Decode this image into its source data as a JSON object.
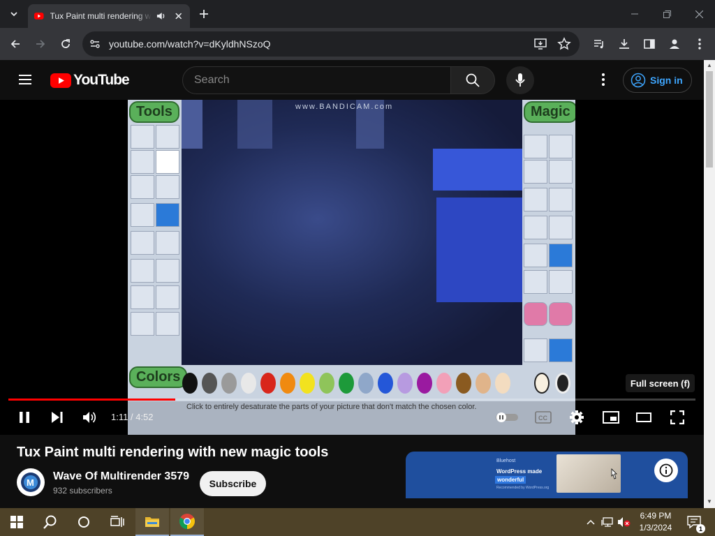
{
  "browser": {
    "tab_title": "Tux Paint multi rendering w",
    "url": "youtube.com/watch?v=dKyldhNSzoQ"
  },
  "youtube": {
    "logo_text": "YouTube",
    "search_placeholder": "Search",
    "sign_in_label": "Sign in"
  },
  "video": {
    "watermark": "www.BANDICAM.com",
    "tuxpaint_tools_label": "Tools",
    "tuxpaint_magic_label": "Magic",
    "tuxpaint_colors_label": "Colors",
    "tuxpaint_status": "Click to entirely desaturate the parts of your picture that don't match the chosen color.",
    "tuxpaint_swatches": [
      "#111111",
      "#555555",
      "#9a9a9a",
      "#e8e8e8",
      "#d8261b",
      "#f08a10",
      "#f2e21f",
      "#8fc45a",
      "#1d9a3a",
      "#8fa7c9",
      "#2457d8",
      "#b79ae0",
      "#9a1aa0",
      "#f2a0b8",
      "#8a5a20",
      "#e0b48a",
      "#f3dcc0"
    ]
  },
  "player": {
    "time_current": "1:11",
    "time_separator": " / ",
    "time_total": "4:52",
    "progress_fraction": 0.243,
    "tooltip": "Full screen (f)"
  },
  "below": {
    "title": "Tux Paint multi rendering with new magic tools",
    "channel_name": "Wave Of Multirender 3579",
    "subscribers": "932 subscribers",
    "subscribe_label": "Subscribe",
    "ad_brand": "Bluehost",
    "ad_line1": "WordPress made",
    "ad_line2": "wonderful",
    "ad_line3": "Recommended by WordPress.org"
  },
  "taskbar": {
    "time": "6:49 PM",
    "date": "1/3/2024",
    "notification_count": "1"
  },
  "colors": {
    "youtube_red": "#ff0000",
    "link_blue": "#3ea6ff",
    "taskbar": "#4e4228"
  }
}
